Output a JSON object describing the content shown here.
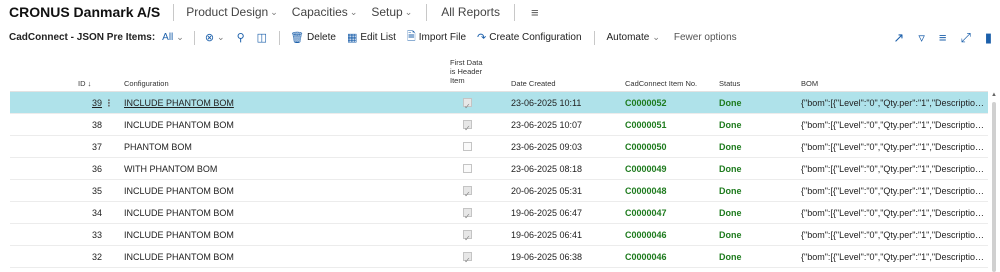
{
  "nav": {
    "company": "CRONUS Danmark A/S",
    "items": [
      {
        "label": "Product Design"
      },
      {
        "label": "Capacities"
      },
      {
        "label": "Setup"
      }
    ],
    "all_reports": "All Reports",
    "menu_icon": "hamburger-icon"
  },
  "actions": {
    "page_title": "CadConnect - JSON Pre Items:",
    "filter_view": "All",
    "delete": "Delete",
    "edit_list": "Edit List",
    "import_file": "Import File",
    "create_configuration": "Create Configuration",
    "automate": "Automate",
    "fewer_options": "Fewer options",
    "icons": [
      "filter-view-icon",
      "search-icon",
      "layout-icon",
      "share-icon",
      "filter-icon",
      "list-icon",
      "expand-icon",
      "bookmark-icon"
    ]
  },
  "columns": {
    "id": "ID ↓",
    "configuration": "Configuration",
    "first_data_l1": "First Data",
    "first_data_l2": "is Header",
    "first_data_l3": "Item",
    "date_created": "Date Created",
    "item_no": "CadConnect Item No.",
    "status": "Status",
    "bom": "BOM"
  },
  "rows": [
    {
      "id": "39",
      "configuration": "INCLUDE PHANTOM BOM",
      "first_data": true,
      "date": "23-06-2025 10:11",
      "item_no": "C0000052",
      "status": "Done",
      "bom": "{\"bom\":[{\"Level\":\"0\",\"Qty.per\":\"1\",\"Description..."
    },
    {
      "id": "38",
      "configuration": "INCLUDE PHANTOM BOM",
      "first_data": true,
      "date": "23-06-2025 10:07",
      "item_no": "C0000051",
      "status": "Done",
      "bom": "{\"bom\":[{\"Level\":\"0\",\"Qty.per\":\"1\",\"Description..."
    },
    {
      "id": "37",
      "configuration": "PHANTOM BOM",
      "first_data": false,
      "date": "23-06-2025 09:03",
      "item_no": "C0000050",
      "status": "Done",
      "bom": "{\"bom\":[{\"Level\":\"0\",\"Qty.per\":\"1\",\"Description..."
    },
    {
      "id": "36",
      "configuration": "WITH PHANTOM BOM",
      "first_data": false,
      "date": "23-06-2025 08:18",
      "item_no": "C0000049",
      "status": "Done",
      "bom": "{\"bom\":[{\"Level\":\"0\",\"Qty.per\":\"1\",\"Description..."
    },
    {
      "id": "35",
      "configuration": "INCLUDE PHANTOM BOM",
      "first_data": true,
      "date": "20-06-2025 05:31",
      "item_no": "C0000048",
      "status": "Done",
      "bom": "{\"bom\":[{\"Level\":\"0\",\"Qty.per\":\"1\",\"Description..."
    },
    {
      "id": "34",
      "configuration": "INCLUDE PHANTOM BOM",
      "first_data": true,
      "date": "19-06-2025 06:47",
      "item_no": "C0000047",
      "status": "Done",
      "bom": "{\"bom\":[{\"Level\":\"0\",\"Qty.per\":\"1\",\"Description..."
    },
    {
      "id": "33",
      "configuration": "INCLUDE PHANTOM BOM",
      "first_data": true,
      "date": "19-06-2025 06:41",
      "item_no": "C0000046",
      "status": "Done",
      "bom": "{\"bom\":[{\"Level\":\"0\",\"Qty.per\":\"1\",\"Description..."
    },
    {
      "id": "32",
      "configuration": "INCLUDE PHANTOM BOM",
      "first_data": true,
      "date": "19-06-2025 06:38",
      "item_no": "C0000046",
      "status": "Done",
      "bom": "{\"bom\":[{\"Level\":\"0\",\"Qty.per\":\"1\",\"Description..."
    }
  ],
  "selected_row": 0,
  "colors": {
    "selected_row_bg": "#afe2ea",
    "done_green": "#1e7b1e",
    "accent_blue": "#1b5faa"
  }
}
